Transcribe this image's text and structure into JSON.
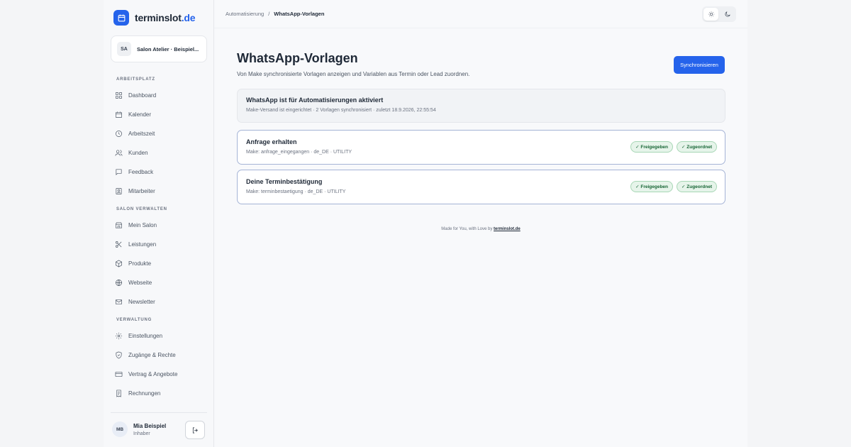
{
  "brand": {
    "name": "terminslot",
    "tld": ".de",
    "accent": "#2563eb"
  },
  "org": {
    "initials": "SA",
    "name": "Salon Atelier · Beispiel..."
  },
  "sidebar": {
    "sections": [
      "Arbeitsplatz",
      "Salon verwalten",
      "Verwaltung"
    ],
    "items": [
      {
        "label": "Dashboard",
        "icon": "dashboard-icon"
      },
      {
        "label": "Kalender",
        "icon": "calendar-icon"
      },
      {
        "label": "Arbeitszeit",
        "icon": "clock-icon"
      },
      {
        "label": "Kunden",
        "icon": "users-icon"
      },
      {
        "label": "Feedback",
        "icon": "message-icon"
      },
      {
        "label": "Mitarbeiter",
        "icon": "id-card-icon"
      },
      {
        "label": "Mein Salon",
        "icon": "store-icon"
      },
      {
        "label": "Leistungen",
        "icon": "scissors-icon"
      },
      {
        "label": "Produkte",
        "icon": "package-icon"
      },
      {
        "label": "Webseite",
        "icon": "globe-icon"
      },
      {
        "label": "Newsletter",
        "icon": "mail-icon"
      },
      {
        "label": "Einstellungen",
        "icon": "gear-icon"
      },
      {
        "label": "Zugänge & Rechte",
        "icon": "shield-icon"
      },
      {
        "label": "Vertrag & Angebote",
        "icon": "credit-card-icon"
      },
      {
        "label": "Rechnungen",
        "icon": "receipt-icon"
      }
    ]
  },
  "user": {
    "initials": "MB",
    "name": "Mia Beispiel",
    "role": "Inhaber"
  },
  "breadcrumb": {
    "parent": "Automatisierung",
    "separator": "/",
    "current": "WhatsApp-Vorlagen"
  },
  "page": {
    "title": "WhatsApp-Vorlagen",
    "subtitle": "Von Make synchronisierte Vorlagen anzeigen und Variablen aus Termin oder Lead zuordnen.",
    "sync_label": "Synchronisieren"
  },
  "status": {
    "title": "WhatsApp ist für Automatisierungen aktiviert",
    "meta": "Make-Versand ist eingerichtet · 2 Vorlagen synchronisiert · zuletzt 18.9.2026, 22:55:54"
  },
  "templates": [
    {
      "title": "Anfrage erhalten",
      "meta": "Make: anfrage_eingegangen · de_DE · UTILITY",
      "badges": [
        "✓ Freigegeben",
        "✓ Zugeordnet"
      ]
    },
    {
      "title": "Deine Terminbestätigung",
      "meta": "Make: terminbestaetigung · de_DE · UTILITY",
      "badges": [
        "✓ Freigegeben",
        "✓ Zugeordnet"
      ]
    }
  ],
  "footer": {
    "text": "Made for You, with Love by",
    "link": "terminslot.de"
  }
}
